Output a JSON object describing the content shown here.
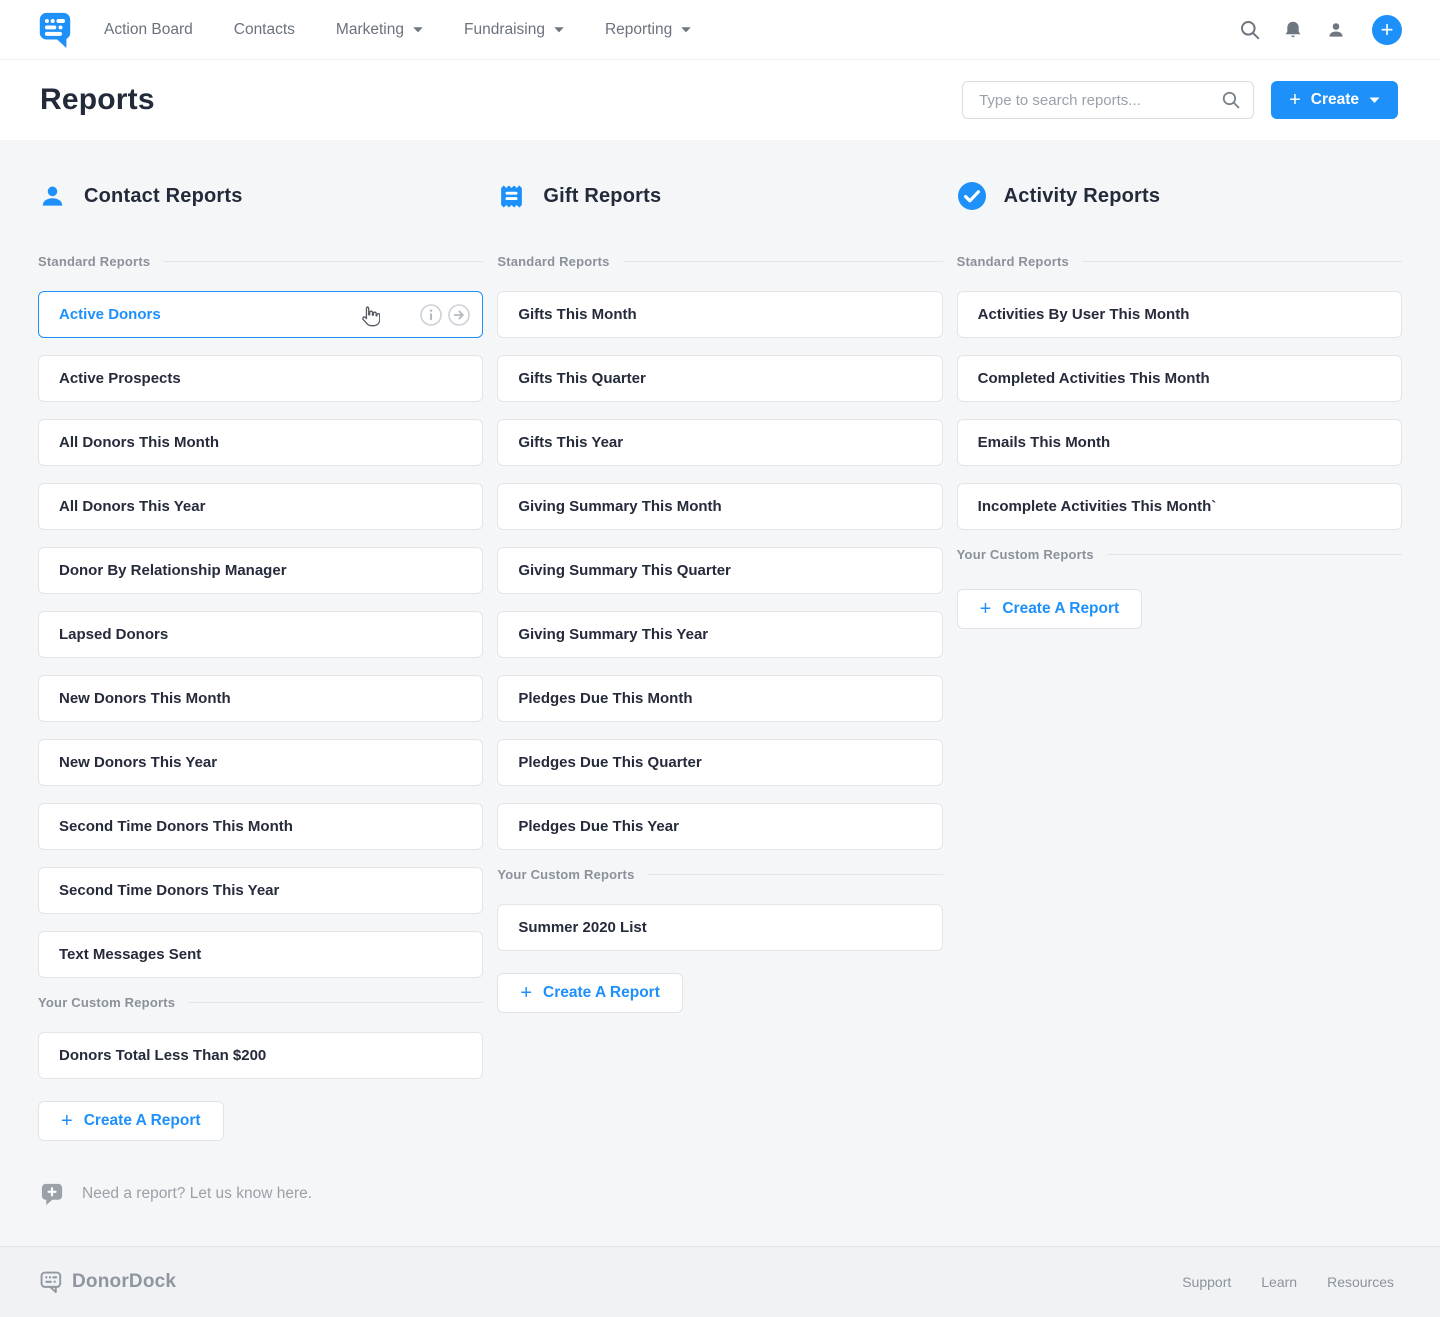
{
  "nav": {
    "items": [
      {
        "label": "Action Board",
        "dropdown": false
      },
      {
        "label": "Contacts",
        "dropdown": false
      },
      {
        "label": "Marketing",
        "dropdown": true
      },
      {
        "label": "Fundraising",
        "dropdown": true
      },
      {
        "label": "Reporting",
        "dropdown": true
      }
    ]
  },
  "header": {
    "title": "Reports",
    "search_placeholder": "Type to search reports...",
    "create_label": "Create"
  },
  "columns": [
    {
      "title": "Contact Reports",
      "icon": "person-icon",
      "standard_label": "Standard Reports",
      "standard_reports": [
        "Active Donors",
        "Active Prospects",
        "All Donors This Month",
        "All Donors This Year",
        "Donor By Relationship Manager",
        "Lapsed Donors",
        "New Donors This Month",
        "New Donors This Year",
        "Second Time Donors This Month",
        "Second Time Donors This Year",
        "Text Messages Sent"
      ],
      "hovered_report": "Active Donors",
      "custom_label": "Your Custom Reports",
      "custom_reports": [
        "Donors Total Less Than $200"
      ],
      "create_button_label": "Create A Report"
    },
    {
      "title": "Gift Reports",
      "icon": "receipt-icon",
      "standard_label": "Standard Reports",
      "standard_reports": [
        "Gifts This Month",
        "Gifts This Quarter",
        "Gifts This Year",
        "Giving Summary This Month",
        "Giving Summary This Quarter",
        "Giving Summary This Year",
        "Pledges Due This Month",
        "Pledges Due This Quarter",
        "Pledges Due This Year"
      ],
      "custom_label": "Your Custom Reports",
      "custom_reports": [
        "Summer 2020 List"
      ],
      "create_button_label": "Create A Report"
    },
    {
      "title": "Activity Reports",
      "icon": "check-circle-icon",
      "standard_label": "Standard Reports",
      "standard_reports": [
        "Activities By User This Month",
        "Completed Activities This Month",
        "Emails This Month",
        "Incomplete Activities This Month`"
      ],
      "custom_label": "Your Custom Reports",
      "custom_reports": [],
      "create_button_label": "Create A Report"
    }
  ],
  "need_report_note": "Need a report? Let us know here.",
  "footer": {
    "brand": "DonorDock",
    "links": [
      "Support",
      "Learn",
      "Resources"
    ]
  },
  "colors": {
    "accent": "#1e90fa",
    "text_dark": "#252b3b",
    "nav_gray": "#6b727d",
    "label_gray": "#8b919b",
    "page_bg": "#f5f6f7",
    "row_border": "#e3e5e9"
  }
}
